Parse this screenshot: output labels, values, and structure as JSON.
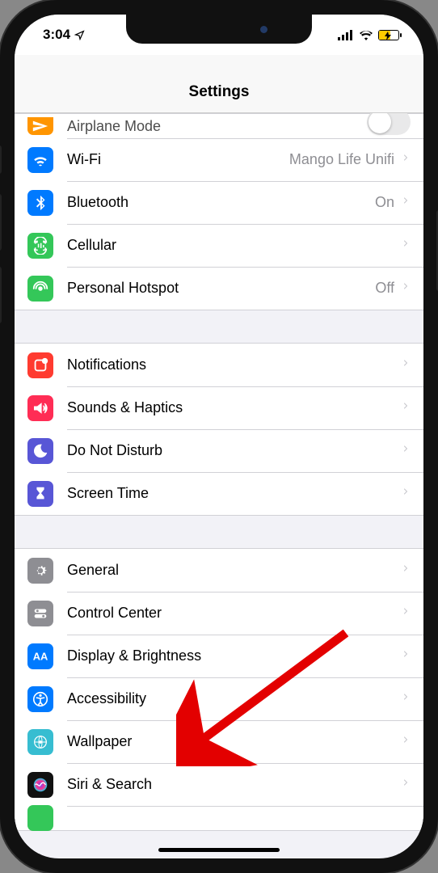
{
  "status": {
    "time": "3:04"
  },
  "navbar": {
    "title": "Settings"
  },
  "sections": [
    {
      "rows": [
        {
          "id": "airplane",
          "label": "Airplane Mode",
          "icon": "airplane-icon",
          "bg": "#ff9500",
          "control": "toggle",
          "toggle": false,
          "clipped": "top"
        },
        {
          "id": "wifi",
          "label": "Wi-Fi",
          "icon": "wifi-icon",
          "bg": "#007aff",
          "value": "Mango Life Unifi",
          "chevron": true
        },
        {
          "id": "bluetooth",
          "label": "Bluetooth",
          "icon": "bluetooth-icon",
          "bg": "#007aff",
          "value": "On",
          "chevron": true
        },
        {
          "id": "cellular",
          "label": "Cellular",
          "icon": "cellular-icon",
          "bg": "#34c759",
          "chevron": true
        },
        {
          "id": "hotspot",
          "label": "Personal Hotspot",
          "icon": "hotspot-icon",
          "bg": "#34c759",
          "value": "Off",
          "chevron": true
        }
      ]
    },
    {
      "rows": [
        {
          "id": "notifications",
          "label": "Notifications",
          "icon": "notifications-icon",
          "bg": "#ff3b30",
          "chevron": true
        },
        {
          "id": "sounds",
          "label": "Sounds & Haptics",
          "icon": "sounds-icon",
          "bg": "#ff2d55",
          "chevron": true
        },
        {
          "id": "dnd",
          "label": "Do Not Disturb",
          "icon": "moon-icon",
          "bg": "#5856d6",
          "chevron": true
        },
        {
          "id": "screentime",
          "label": "Screen Time",
          "icon": "hourglass-icon",
          "bg": "#5856d6",
          "chevron": true
        }
      ]
    },
    {
      "rows": [
        {
          "id": "general",
          "label": "General",
          "icon": "gear-icon",
          "bg": "#8e8e93",
          "chevron": true
        },
        {
          "id": "controlcenter",
          "label": "Control Center",
          "icon": "switches-icon",
          "bg": "#8e8e93",
          "chevron": true
        },
        {
          "id": "display",
          "label": "Display & Brightness",
          "icon": "display-icon",
          "bg": "#007aff",
          "chevron": true
        },
        {
          "id": "accessibility",
          "label": "Accessibility",
          "icon": "accessibility-icon",
          "bg": "#007aff",
          "chevron": true
        },
        {
          "id": "wallpaper",
          "label": "Wallpaper",
          "icon": "wallpaper-icon",
          "bg": "#37bdd1",
          "chevron": true
        },
        {
          "id": "siri",
          "label": "Siri & Search",
          "icon": "siri-icon",
          "bg": "#111",
          "chevron": true
        },
        {
          "id": "next",
          "label": "",
          "icon": "blank-icon",
          "bg": "#34c759",
          "clipped": "bottom"
        }
      ]
    }
  ],
  "annotation": {
    "target": "accessibility"
  }
}
